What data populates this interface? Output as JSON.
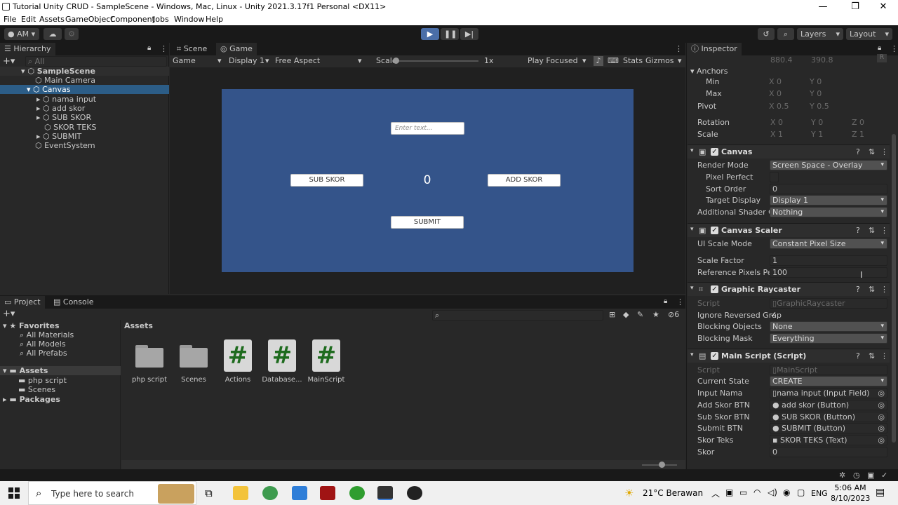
{
  "window": {
    "title": "Tutorial Unity CRUD - SampleScene - Windows, Mac, Linux - Unity 2021.3.17f1 Personal <DX11>",
    "minimize": "—",
    "maximize": "❐",
    "close": "✕"
  },
  "menu": [
    "File",
    "Edit",
    "Assets",
    "GameObject",
    "Component",
    "Jobs",
    "Window",
    "Help"
  ],
  "toolbar": {
    "account": "AM",
    "layers": "Layers",
    "layout": "Layout"
  },
  "hierarchy": {
    "tab": "Hierarchy",
    "search_placeholder": "All",
    "items": [
      {
        "label": "SampleScene"
      },
      {
        "label": "Main Camera"
      },
      {
        "label": "Canvas"
      },
      {
        "label": "nama input"
      },
      {
        "label": "add skor"
      },
      {
        "label": "SUB SKOR"
      },
      {
        "label": "SKOR TEKS"
      },
      {
        "label": "SUBMIT"
      },
      {
        "label": "EventSystem"
      }
    ]
  },
  "game_view": {
    "tabs": [
      "Scene",
      "Game"
    ],
    "display_mode": "Game",
    "display": "Display 1",
    "aspect": "Free Aspect",
    "scale_label": "Scale",
    "scale_value": "1x",
    "play_mode": "Play Focused",
    "stats": "Stats",
    "gizmos": "Gizmos",
    "canvas": {
      "input_placeholder": "Enter text...",
      "sub_button": "SUB SKOR",
      "score": "0",
      "add_button": "ADD SKOR",
      "submit_button": "SUBMIT",
      "background": "#34548a"
    }
  },
  "project": {
    "tabs": [
      "Project",
      "Console"
    ],
    "favorites_label": "Favorites",
    "favorites": [
      "All Materials",
      "All Models",
      "All Prefabs"
    ],
    "assets_label": "Assets",
    "asset_folders": [
      "php script",
      "Scenes"
    ],
    "packages_label": "Packages",
    "breadcrumb": "Assets",
    "hidden_count": "6",
    "items": [
      {
        "label": "php script",
        "kind": "folder"
      },
      {
        "label": "Scenes",
        "kind": "folder"
      },
      {
        "label": "Actions",
        "kind": "script"
      },
      {
        "label": "Database...",
        "kind": "script"
      },
      {
        "label": "MainScript",
        "kind": "script"
      }
    ]
  },
  "inspector": {
    "tab": "Inspector",
    "top_values": [
      "880.4",
      "390.8"
    ],
    "rect": {
      "anchors": "Anchors",
      "min": "Min",
      "max": "Max",
      "pivot": "Pivot",
      "rotation": "Rotation",
      "scale": "Scale",
      "min_x": "0",
      "min_y": "0",
      "max_x": "0",
      "max_y": "0",
      "pivot_x": "0.5",
      "pivot_y": "0.5",
      "rot_x": "0",
      "rot_y": "0",
      "rot_z": "0",
      "scale_x": "1",
      "scale_y": "1",
      "scale_z": "1",
      "x": "X",
      "y": "Y",
      "z": "Z"
    },
    "canvas": {
      "title": "Canvas",
      "render_mode_label": "Render Mode",
      "render_mode": "Screen Space - Overlay",
      "pixel_perfect_label": "Pixel Perfect",
      "sort_order_label": "Sort Order",
      "sort_order": "0",
      "target_display_label": "Target Display",
      "target_display": "Display 1",
      "shader_label": "Additional Shader Ch",
      "shader": "Nothing"
    },
    "scaler": {
      "title": "Canvas Scaler",
      "mode_label": "UI Scale Mode",
      "mode": "Constant Pixel Size",
      "factor_label": "Scale Factor",
      "factor": "1",
      "ref_label": "Reference Pixels Per",
      "ref": "100"
    },
    "raycaster": {
      "title": "Graphic Raycaster",
      "script_label": "Script",
      "script": "GraphicRaycaster",
      "ignore_label": "Ignore Reversed Grap",
      "blocking_objects_label": "Blocking Objects",
      "blocking_objects": "None",
      "blocking_mask_label": "Blocking Mask",
      "blocking_mask": "Everything"
    },
    "main_script": {
      "title": "Main Script (Script)",
      "script_label": "Script",
      "script": "MainScript",
      "state_label": "Current State",
      "state": "CREATE",
      "input_label": "Input Nama",
      "input": "nama input (Input Field)",
      "add_label": "Add Skor BTN",
      "add": "add skor (Button)",
      "sub_label": "Sub Skor BTN",
      "sub": "SUB SKOR (Button)",
      "submit_label": "Submit BTN",
      "submit": "SUBMIT (Button)",
      "teks_label": "Skor Teks",
      "teks": "SKOR TEKS (Text)",
      "skor_label": "Skor",
      "skor": "0"
    }
  },
  "taskbar": {
    "search_placeholder": "Type here to search",
    "weather": "21°C  Berawan",
    "lang": "ENG",
    "time": "5:06 AM",
    "date": "8/10/2023"
  }
}
